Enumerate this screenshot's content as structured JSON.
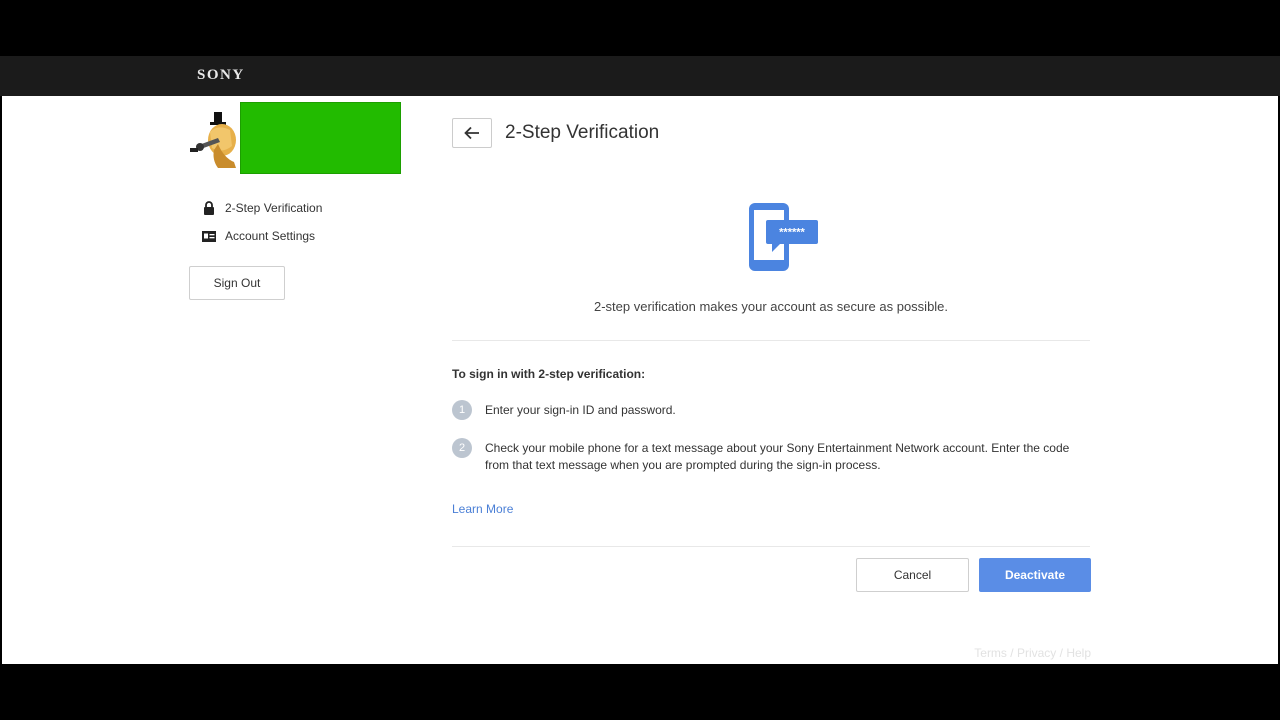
{
  "header": {
    "brand": "SONY"
  },
  "sidebar": {
    "items": [
      {
        "label": "2-Step Verification",
        "icon": "lock-icon"
      },
      {
        "label": "Account Settings",
        "icon": "id-card-icon"
      }
    ],
    "sign_out_label": "Sign Out"
  },
  "main": {
    "title": "2-Step Verification",
    "tagline": "2-step verification makes your account as secure as possible.",
    "steps_heading": "To sign in with 2-step verification:",
    "steps": [
      {
        "number": "1",
        "text": "Enter your sign-in ID and password."
      },
      {
        "number": "2",
        "text": "Check your mobile phone for a text message about your Sony Entertainment Network account. Enter the code from that text message when you are prompted during the sign-in process."
      }
    ],
    "learn_more": "Learn More",
    "hero_badge": "******",
    "cancel_label": "Cancel",
    "deactivate_label": "Deactivate"
  },
  "footer": {
    "terms": "Terms",
    "privacy": "Privacy",
    "help": "Help",
    "separator": " / "
  },
  "colors": {
    "accent": "#5a8de6",
    "link": "#4a7fd6",
    "header_bg": "#1b1b1b",
    "redaction": "#22bb00"
  }
}
